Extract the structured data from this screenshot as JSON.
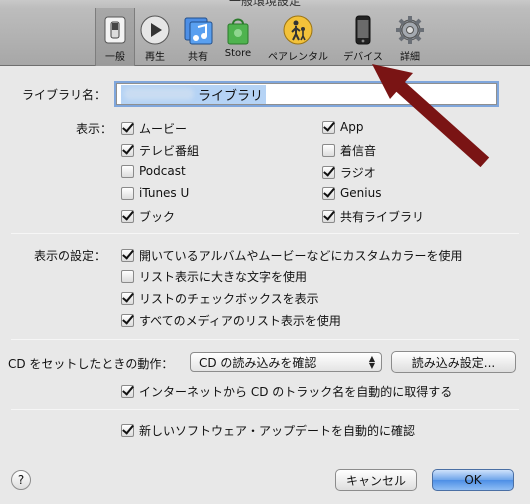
{
  "window": {
    "title": "一般環境設定"
  },
  "toolbar": {
    "items": [
      {
        "label": "一般",
        "icon": "switch-icon",
        "active": true
      },
      {
        "label": "再生",
        "icon": "play-icon"
      },
      {
        "label": "共有",
        "icon": "music-folder-icon"
      },
      {
        "label": "Store",
        "icon": "shopping-bag-icon"
      },
      {
        "label": "ペアレンタル",
        "icon": "parental-icon"
      },
      {
        "label": "デバイス",
        "icon": "iphone-icon"
      },
      {
        "label": "詳細",
        "icon": "gear-icon"
      }
    ]
  },
  "library": {
    "name_label": "ライブラリ名：",
    "name_value": "ライブラリ"
  },
  "show": {
    "label": "表示：",
    "left": [
      {
        "label": "ムービー",
        "checked": true
      },
      {
        "label": "テレビ番組",
        "checked": true
      },
      {
        "label": "Podcast",
        "checked": false
      },
      {
        "label": "iTunes U",
        "checked": false
      },
      {
        "label": "ブック",
        "checked": true
      }
    ],
    "right": [
      {
        "label": "App",
        "checked": true
      },
      {
        "label": "着信音",
        "checked": false
      },
      {
        "label": "ラジオ",
        "checked": true
      },
      {
        "label": "Genius",
        "checked": true
      },
      {
        "label": "共有ライブラリ",
        "checked": true
      }
    ]
  },
  "display_settings": {
    "label": "表示の設定：",
    "options": [
      {
        "label": "開いているアルバムやムービーなどにカスタムカラーを使用",
        "checked": true
      },
      {
        "label": "リスト表示に大きな文字を使用",
        "checked": false
      },
      {
        "label": "リストのチェックボックスを表示",
        "checked": true
      },
      {
        "label": "すべてのメディアのリスト表示を使用",
        "checked": true
      }
    ]
  },
  "cd": {
    "label": "CD をセットしたときの動作：",
    "action_value": "CD の読み込みを確認",
    "import_settings_button": "読み込み設定...",
    "auto_names": {
      "label": "インターネットから CD のトラック名を自動的に取得する",
      "checked": true
    }
  },
  "updates": {
    "label": "新しいソフトウェア・アップデートを自動的に確認",
    "checked": true
  },
  "footer": {
    "help": "?",
    "cancel": "キャンセル",
    "ok": "OK"
  },
  "colors": {
    "arrow": "#7a1414",
    "ok_button": "#4d8fe6",
    "focus_ring": "#7fa6dc"
  }
}
